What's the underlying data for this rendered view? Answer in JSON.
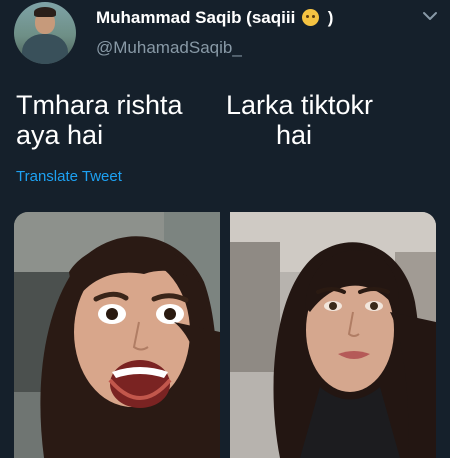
{
  "tweet": {
    "author": {
      "display_name": "Muhammad Saqib (saqiii",
      "display_name_end": ")",
      "emoji": "smiling-face-emoji",
      "handle": "@MuhamadSaqib_"
    },
    "text": {
      "line1_left": "Tmhara rishta",
      "line1_right": "Larka tiktokr",
      "line2_left": "aya hai",
      "line2_right": "hai"
    },
    "translate_label": "Translate Tweet",
    "media": [
      "photo-surprised-face",
      "photo-serious-face"
    ],
    "menu_icon": "chevron-down-icon"
  },
  "colors": {
    "background": "#15202b",
    "primary_text": "#ffffff",
    "secondary_text": "#8899a6",
    "link": "#1da1f2"
  }
}
